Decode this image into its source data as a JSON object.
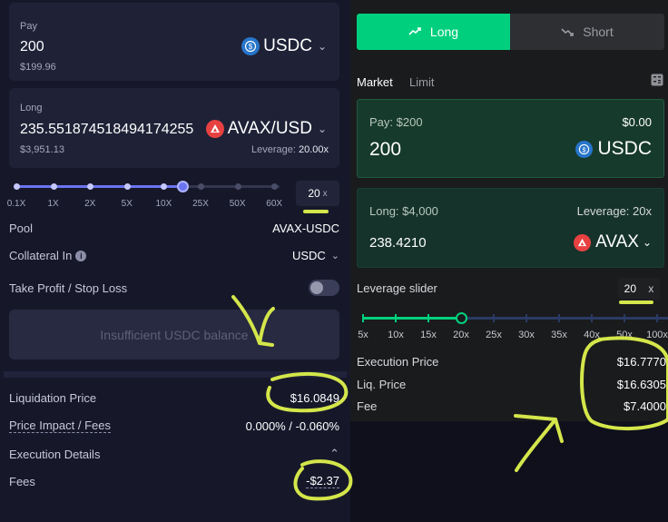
{
  "left": {
    "pay": {
      "label": "Pay",
      "amount": "200",
      "usd": "$199.96",
      "token": "USDC"
    },
    "long": {
      "label": "Long",
      "amount": "235.551874518494174255",
      "usd": "$3,951.13",
      "token": "AVAX/USD",
      "leverage_label": "Leverage:",
      "leverage_value": "20.00x"
    },
    "slider": {
      "ticks": [
        "0.1X",
        "1X",
        "2X",
        "5X",
        "10X",
        "25X",
        "50X",
        "60X"
      ],
      "level": 20,
      "value": "20",
      "unit": "x"
    },
    "pool": {
      "label": "Pool",
      "value": "AVAX-USDC"
    },
    "collateral": {
      "label": "Collateral In",
      "value": "USDC"
    },
    "tpsl": {
      "label": "Take Profit / Stop Loss"
    },
    "action_button": "Insufficient USDC balance",
    "liquidation": {
      "label": "Liquidation Price",
      "value": "$16.0849"
    },
    "impact": {
      "label": "Price Impact / Fees",
      "value": "0.000% / -0.060%"
    },
    "execution": {
      "label": "Execution Details"
    },
    "fees": {
      "label": "Fees",
      "value": "-$2.37"
    }
  },
  "right": {
    "tabs": {
      "long": "Long",
      "short": "Short"
    },
    "order_types": {
      "market": "Market",
      "limit": "Limit"
    },
    "pay": {
      "label": "Pay: $200",
      "balance": "$0.00",
      "amount": "200",
      "token": "USDC"
    },
    "long": {
      "label": "Long: $4,000",
      "leverage": "Leverage: 20x",
      "amount": "238.4210",
      "token": "AVAX"
    },
    "slider": {
      "label": "Leverage slider",
      "value": "20",
      "unit": "x",
      "level": 20,
      "ticks": [
        "5x",
        "10x",
        "15x",
        "20x",
        "25x",
        "30x",
        "35x",
        "40x",
        "50x",
        "100x"
      ]
    },
    "execution_price": {
      "label": "Execution Price",
      "value": "$16.7770"
    },
    "liq_price": {
      "label": "Liq. Price",
      "value": "$16.6305"
    },
    "fee": {
      "label": "Fee",
      "value": "$7.4000"
    }
  },
  "colors": {
    "accent_green": "#00d07e",
    "slider_purple": "#6b74f0",
    "annotation": "#d4e64a"
  },
  "icons": [
    "usdc-icon",
    "avax-icon",
    "chevron-down-icon",
    "info-icon",
    "trend-up-icon",
    "trend-down-icon",
    "calculator-icon",
    "chevron-up-icon"
  ]
}
